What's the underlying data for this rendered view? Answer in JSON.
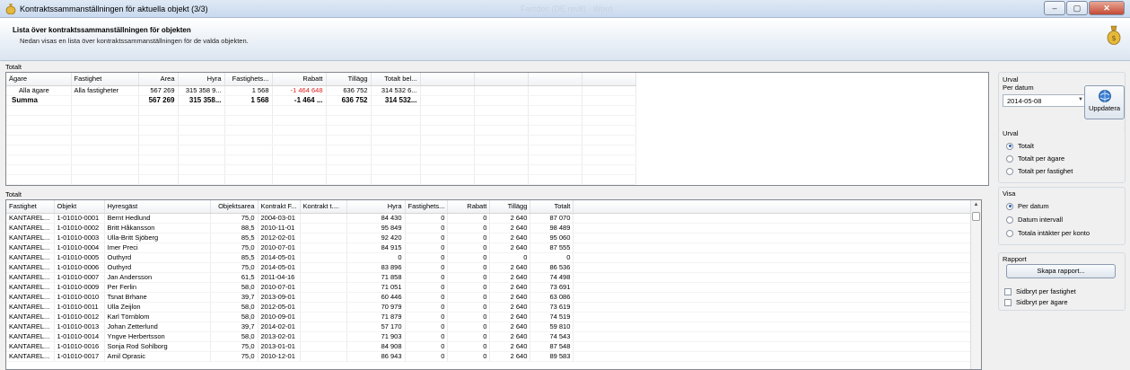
{
  "window": {
    "title": "Kontraktssammanställningen för aktuella objekt (3/3)",
    "blurred_text": "Fastdoc (DE rev8) - Word",
    "minimize_label": "–",
    "maximize_label": "▢",
    "close_label": "✕"
  },
  "header": {
    "title": "Lista över kontraktssammanställningen för objekten",
    "subtitle": "Nedan visas en lista över kontraktssammanställningen för de valda objekten."
  },
  "top_section": {
    "label": "Totalt",
    "columns": [
      "Ägare",
      "Fastighet",
      "Area",
      "Hyra",
      "Fastighets...",
      "Rabatt",
      "Tillägg",
      "Totalt bel..."
    ],
    "rows": [
      [
        "Alla ägare",
        "Alla fastigheter",
        "567 269",
        "315 358 9...",
        "1 568",
        "-1 464 648",
        "636 752",
        "314 532 6..."
      ],
      [
        "Summa",
        "",
        "567 269",
        "315 358...",
        "1 568",
        "-1 464 ...",
        "636 752",
        "314 532..."
      ]
    ]
  },
  "bottom_section": {
    "label": "Totalt",
    "columns": [
      "Fastighet",
      "Objekt",
      "Hyresgäst",
      "Objektsarea",
      "Kontrakt F...",
      "Kontrakt t....",
      "Hyra",
      "Fastighets...",
      "Rabatt",
      "Tillägg",
      "Totalt"
    ],
    "rows": [
      [
        "KANTAREL...",
        "1-01010-0001",
        "Bernt Hedlund",
        "75,0",
        "2004-03-01",
        "",
        "84 430",
        "0",
        "0",
        "2 640",
        "87 070"
      ],
      [
        "KANTAREL...",
        "1-01010-0002",
        "Britt Håkansson",
        "88,5",
        "2010-11-01",
        "",
        "95 849",
        "0",
        "0",
        "2 640",
        "98 489"
      ],
      [
        "KANTAREL...",
        "1-01010-0003",
        "Ulla-Britt Sjöberg",
        "85,5",
        "2012-02-01",
        "",
        "92 420",
        "0",
        "0",
        "2 640",
        "95 060"
      ],
      [
        "KANTAREL...",
        "1-01010-0004",
        "Imer Preci",
        "75,0",
        "2010-07-01",
        "",
        "84 915",
        "0",
        "0",
        "2 640",
        "87 555"
      ],
      [
        "KANTAREL...",
        "1-01010-0005",
        "Outhyrd",
        "85,5",
        "2014-05-01",
        "",
        "0",
        "0",
        "0",
        "0",
        "0"
      ],
      [
        "KANTAREL...",
        "1-01010-0006",
        "Outhyrd",
        "75,0",
        "2014-05-01",
        "",
        "83 896",
        "0",
        "0",
        "2 640",
        "86 536"
      ],
      [
        "KANTAREL...",
        "1-01010-0007",
        "Jan Andersson",
        "61,5",
        "2011-04-16",
        "",
        "71 858",
        "0",
        "0",
        "2 640",
        "74 498"
      ],
      [
        "KANTAREL...",
        "1-01010-0009",
        "Per Ferlin",
        "58,0",
        "2010-07-01",
        "",
        "71 051",
        "0",
        "0",
        "2 640",
        "73 691"
      ],
      [
        "KANTAREL...",
        "1-01010-0010",
        "Tsnat Brhane",
        "39,7",
        "2013-09-01",
        "",
        "60 446",
        "0",
        "0",
        "2 640",
        "63 086"
      ],
      [
        "KANTAREL...",
        "1-01010-0011",
        "Ulla Zeijlon",
        "58,0",
        "2012-05-01",
        "",
        "70 979",
        "0",
        "0",
        "2 640",
        "73 619"
      ],
      [
        "KANTAREL...",
        "1-01010-0012",
        "Karl Törnblom",
        "58,0",
        "2010-09-01",
        "",
        "71 879",
        "0",
        "0",
        "2 640",
        "74 519"
      ],
      [
        "KANTAREL...",
        "1-01010-0013",
        "Johan Zetterlund",
        "39,7",
        "2014-02-01",
        "",
        "57 170",
        "0",
        "0",
        "2 640",
        "59 810"
      ],
      [
        "KANTAREL...",
        "1-01010-0014",
        "Yngve Herbertsson",
        "58,0",
        "2013-02-01",
        "",
        "71 903",
        "0",
        "0",
        "2 640",
        "74 543"
      ],
      [
        "KANTAREL...",
        "1-01010-0016",
        "Sonja Rod Sohlborg",
        "75,0",
        "2013-01-01",
        "",
        "84 908",
        "0",
        "0",
        "2 640",
        "87 548"
      ],
      [
        "KANTAREL...",
        "1-01010-0017",
        "Amil Oprasic",
        "75,0",
        "2010-12-01",
        "",
        "86 943",
        "0",
        "0",
        "2 640",
        "89 583"
      ]
    ]
  },
  "urval_date": {
    "title": "Urval",
    "subtitle": "Per datum",
    "date_value": "2014-05-08",
    "update_label": "Uppdatera"
  },
  "urval_options": {
    "title": "Urval",
    "options": [
      "Totalt",
      "Totalt per ägare",
      "Totalt per fastighet"
    ],
    "selected": "Totalt"
  },
  "visa": {
    "title": "Visa",
    "options": [
      "Per datum",
      "Datum intervall",
      "Totala intäkter per konto"
    ],
    "selected": "Per datum"
  },
  "rapport": {
    "title": "Rapport",
    "button_label": "Skapa rapport...",
    "checks": [
      "Sidbryt per fastighet",
      "Sidbryt per ägare"
    ]
  },
  "colors": {
    "negative": "#e02020",
    "accent": "#2a5fb5"
  }
}
